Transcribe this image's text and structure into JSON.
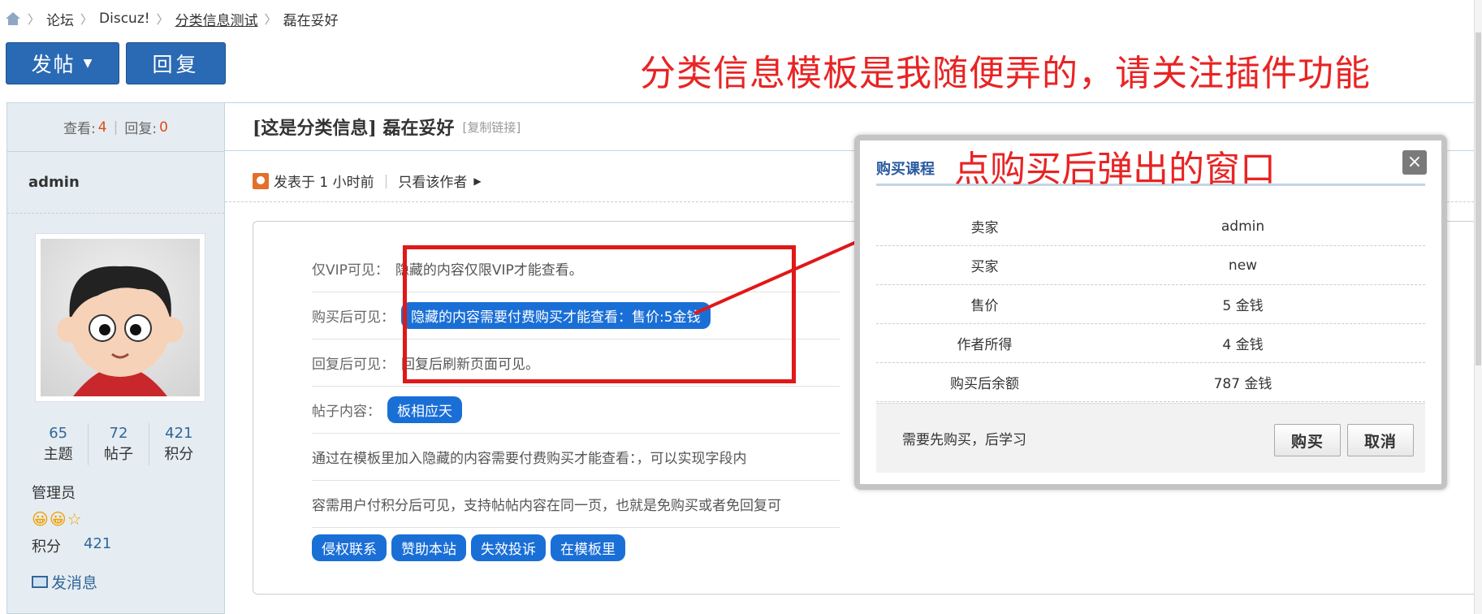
{
  "breadcrumb": [
    "论坛",
    "Discuz!",
    "分类信息测试",
    "磊在妥好"
  ],
  "actions": {
    "post": "发帖",
    "reply": "回复"
  },
  "annotation_top": "分类信息模板是我随便弄的，请关注插件功能",
  "sidebar": {
    "views_label": "查看:",
    "views": "4",
    "replies_label": "回复:",
    "replies": "0",
    "username": "admin",
    "counts": [
      {
        "value": "65",
        "label": "主题"
      },
      {
        "value": "72",
        "label": "帖子"
      },
      {
        "value": "421",
        "label": "积分"
      }
    ],
    "role": "管理员",
    "smileys": "😀😀☆",
    "points_label": "积分",
    "points": "421",
    "message": "发消息"
  },
  "thread": {
    "title": "[这是分类信息] 磊在妥好",
    "copy_link": "[复制链接]",
    "posted": "发表于 1 小时前",
    "author_only": "只看该作者"
  },
  "content": {
    "rows": [
      {
        "label": "仅VIP可见：",
        "text": "隐藏的内容仅限VIP才能查看。"
      },
      {
        "label": "购买后可见：",
        "pill": "隐藏的内容需要付费购买才能查看：售价:5金钱"
      },
      {
        "label": "回复后可见：",
        "text": "回复后刷新页面可见。"
      },
      {
        "label": "帖子内容：",
        "pill": "板相应天"
      },
      {
        "text": "通过在模板里加入隐藏的内容需要付费购买才能查看：，可以实现字段内"
      },
      {
        "text": "容需用户付积分后可见，支持帖帖内容在同一页，也就是免购买或者免回复可"
      }
    ],
    "pills": [
      "侵权联系",
      "赞助本站",
      "失效投诉",
      "在模板里"
    ]
  },
  "popup": {
    "title": "购买课程",
    "annotation": "点购买后弹出的窗口",
    "close": "×",
    "rows": [
      {
        "k": "卖家",
        "v": "admin"
      },
      {
        "k": "买家",
        "v": "new"
      },
      {
        "k": "售价",
        "v": "5 金钱"
      },
      {
        "k": "作者所得",
        "v": "4 金钱"
      },
      {
        "k": "购买后余额",
        "v": "787 金钱"
      }
    ],
    "footer_note": "需要先购买，后学习",
    "buy": "购买",
    "cancel": "取消"
  },
  "colors": {
    "accent": "#2a6ab4",
    "annotation_red": "#e82424",
    "pill_blue": "#1a6fd6"
  }
}
